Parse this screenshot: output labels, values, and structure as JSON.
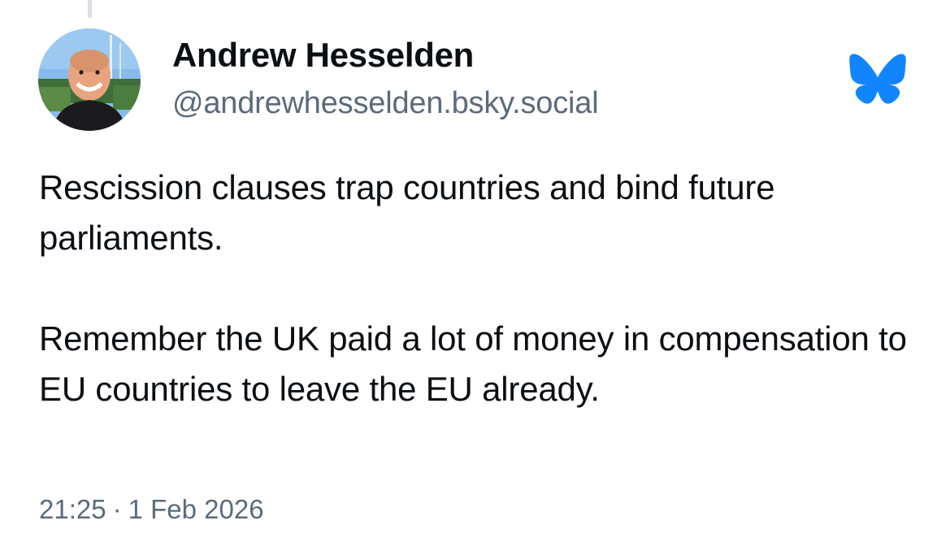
{
  "post": {
    "author": {
      "display_name": "Andrew Hesselden",
      "handle": "@andrewhesselden.bsky.social",
      "avatar_icon": "avatar-photo"
    },
    "brand_icon": "bluesky-butterfly-icon",
    "brand_color": "#1185fe",
    "paragraphs": [
      "Rescission clauses trap countries and bind future parliaments.",
      "Remember the UK paid a lot of money in compensation to EU countries to leave the EU already."
    ],
    "time": "21:25",
    "separator": "·",
    "date": "1 Feb 2026"
  }
}
